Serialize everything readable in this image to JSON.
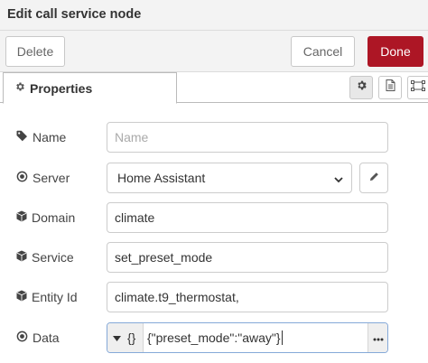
{
  "header": {
    "title": "Edit call service node"
  },
  "toolbar": {
    "delete_label": "Delete",
    "cancel_label": "Cancel",
    "done_label": "Done"
  },
  "tabs": {
    "active_label": "Properties",
    "icons": [
      "gear-icon",
      "description-icon",
      "appearance-icon"
    ]
  },
  "form": {
    "name": {
      "label": "Name",
      "value": "",
      "placeholder": "Name"
    },
    "server": {
      "label": "Server",
      "value": "Home Assistant"
    },
    "domain": {
      "label": "Domain",
      "value": "climate"
    },
    "service": {
      "label": "Service",
      "value": "set_preset_mode"
    },
    "entity_id": {
      "label": "Entity Id",
      "value": "climate.t9_thermostat,"
    },
    "data": {
      "label": "Data",
      "type_label": "{}",
      "value": "{\"preset_mode\":\"away\"}"
    }
  },
  "colors": {
    "primary": "#ad1625",
    "focus_border": "#85a9d8"
  }
}
